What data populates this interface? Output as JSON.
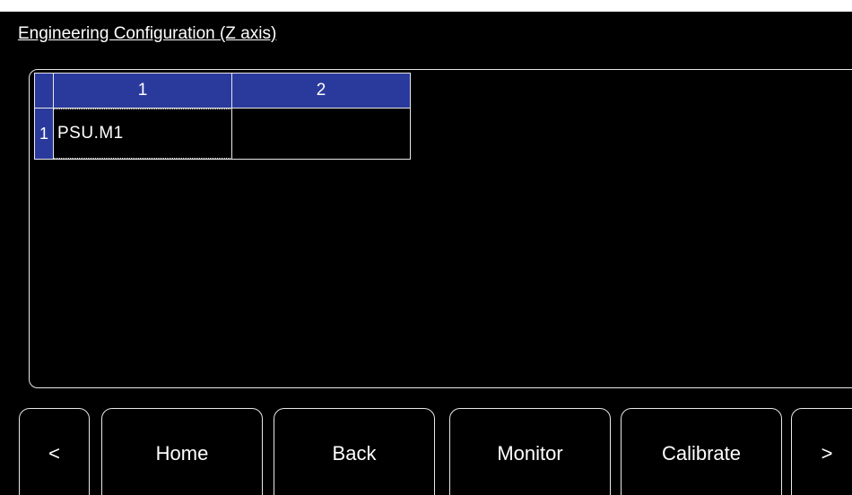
{
  "header": {
    "title": "Engineering Configuration (Z axis)"
  },
  "grid": {
    "columns": [
      "1",
      "2"
    ],
    "rows": [
      {
        "label": "1",
        "cells": [
          "PSU.M1",
          ""
        ]
      }
    ],
    "selected_cell": "1,1"
  },
  "navigation": {
    "prev_label": "<",
    "home_label": "Home",
    "back_label": "Back",
    "monitor_label": "Monitor",
    "calibrate_label": "Calibrate",
    "next_label": ">"
  },
  "colors": {
    "background": "#000000",
    "header_fill": "#2a3a9c",
    "border": "#e8e8e8",
    "text": "#ffffff"
  }
}
